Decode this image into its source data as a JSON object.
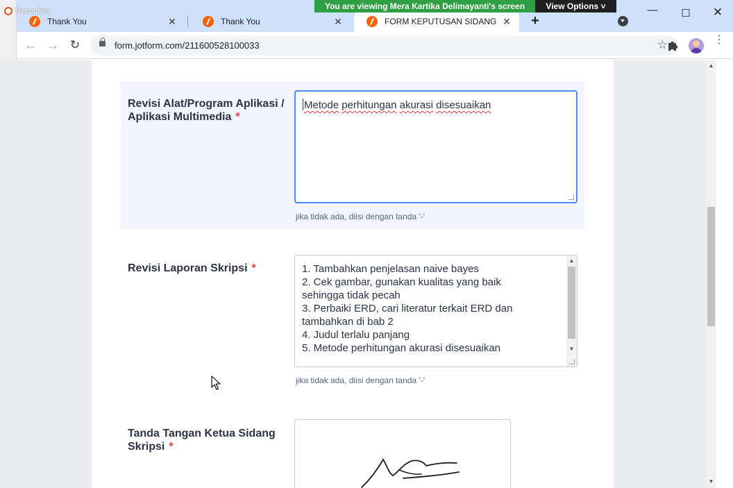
{
  "overlay": {
    "recording_label": "Recording",
    "viewing_banner": "You are viewing Mera Kartika Delimayanti's screen",
    "view_options": "View Options ˅"
  },
  "desktop": {
    "edge_mark": "6"
  },
  "browser": {
    "tabs": [
      {
        "label": "Thank You",
        "close": "✕",
        "active": false
      },
      {
        "label": "Thank You",
        "close": "✕",
        "active": false
      },
      {
        "label": "FORM KEPUTUSAN SIDANG",
        "close": "✕",
        "active": true
      }
    ],
    "new_tab": "+",
    "window_controls": {
      "minimize": "—",
      "maximize": "☐",
      "close": "✕"
    },
    "nav": {
      "back": "←",
      "forward": "→",
      "reload": "↻"
    },
    "url": "form.jotform.com/211600528100033",
    "bookmark": "☆",
    "menu": "⋮"
  },
  "form": {
    "q_alat": {
      "label": "Revisi Alat/Program Aplikasi / Aplikasi Multimedia",
      "required": "*",
      "value_words": [
        "Metode",
        " ",
        "perhitungan",
        " ",
        "akurasi",
        " ",
        "disesuaikan"
      ],
      "sublabel": "jika tidak ada, diisi dengan tanda '-'"
    },
    "q_laporan": {
      "label": "Revisi Laporan Skripsi",
      "required": "*",
      "lines": [
        "1. Tambahkan penjelasan naive bayes",
        "2. Cek gambar, gunakan kualitas yang baik",
        "sehingga tidak pecah",
        "3. Perbaiki ERD, cari literatur terkait ERD dan",
        "tambahkan di bab 2",
        "4. Judul terlalu panjang",
        "5. Metode perhitungan akurasi disesuaikan"
      ],
      "sublabel": "jika tidak ada, diisi dengan tanda '-'"
    },
    "q_ttd": {
      "label": "Tanda Tangan Ketua Sidang Skripsi",
      "required": "*"
    }
  },
  "icons": {
    "lock": "lock-icon",
    "star": "star-icon",
    "extensions": "puzzle-icon",
    "profile": "avatar",
    "tab_search": "chevron-down-icon",
    "favicon": "jotform-icon"
  },
  "colors": {
    "tabstrip": "#cfe0fb",
    "banner_green": "#2ea043",
    "focus_border": "#4e8bf0",
    "required_star": "#f23a3c",
    "row_highlight": "#f2f5fe",
    "page_bg": "#ebecf0"
  }
}
